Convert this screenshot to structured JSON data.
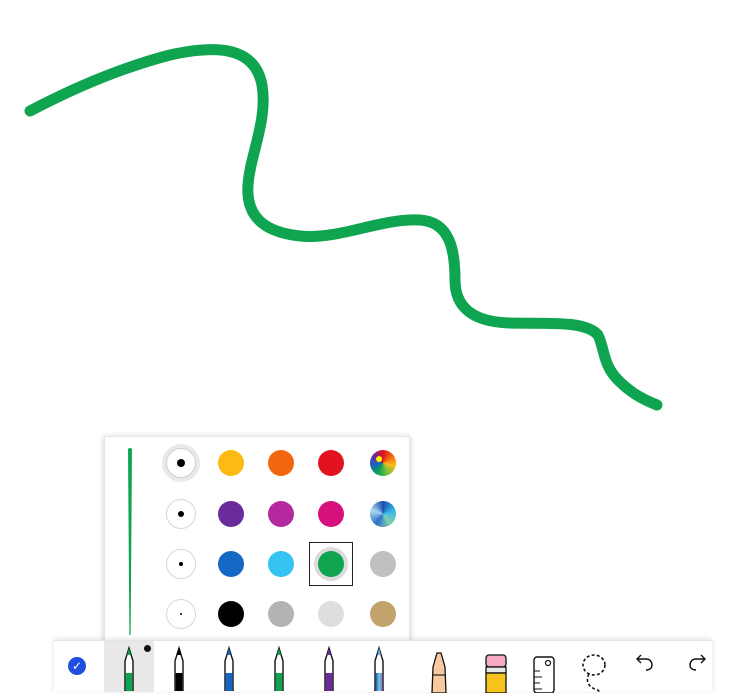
{
  "ink": {
    "color": "#0FA44F"
  },
  "palette": {
    "sizes": [
      "xl",
      "l",
      "m",
      "s"
    ],
    "selected_size": "xl",
    "colors": [
      [
        "#FDBA12",
        "#F2660D",
        "#E2131E",
        "rainbow-gradient"
      ],
      [
        "#6A2B9C",
        "#B5299E",
        "#D6117E",
        "ocean-gradient"
      ],
      [
        "#1467C2",
        "#34C3F3",
        "#0FA44F",
        "#C0C0C0"
      ],
      [
        "#000000",
        "#B3B3B3",
        "#DEDEDE",
        "#C2A36B"
      ]
    ],
    "selected_color": "#0FA44F"
  },
  "toolbar": {
    "tools": [
      {
        "name": "select-tool",
        "icon": "check-circle-icon"
      },
      {
        "name": "pen-green",
        "icon": "pen-icon",
        "color": "#0FA44F",
        "active": true
      },
      {
        "name": "pen-black",
        "icon": "pen-icon",
        "color": "#000000"
      },
      {
        "name": "pen-blue",
        "icon": "pen-icon",
        "color": "#1467C2"
      },
      {
        "name": "pen-green-2",
        "icon": "pen-icon",
        "color": "#0FA44F"
      },
      {
        "name": "pen-purple",
        "icon": "pen-icon",
        "color": "#6A2B9C"
      },
      {
        "name": "pen-galaxy",
        "icon": "pen-icon",
        "color": "#3aa0c8"
      },
      {
        "name": "highlighter",
        "icon": "highlighter-icon",
        "color": "#F8C89E"
      },
      {
        "name": "eraser",
        "icon": "eraser-icon",
        "color": "#F7C21A"
      },
      {
        "name": "ruler",
        "icon": "ruler-icon"
      },
      {
        "name": "lasso",
        "icon": "lasso-icon"
      },
      {
        "name": "undo",
        "icon": "undo-icon"
      },
      {
        "name": "redo",
        "icon": "redo-icon"
      }
    ]
  }
}
